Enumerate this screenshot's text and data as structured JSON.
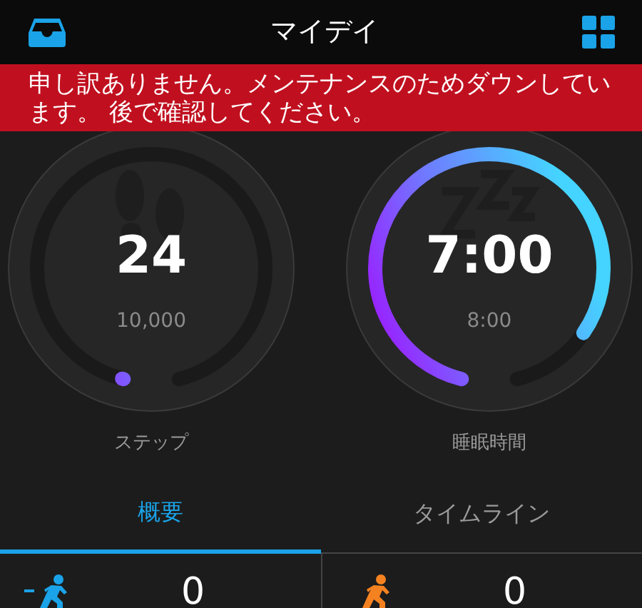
{
  "header": {
    "title": "マイデイ"
  },
  "banner": {
    "message": "申し訳ありません。メンテナンスのためダウンしています。 後で確認してください。"
  },
  "dials": [
    {
      "kind": "steps",
      "value": "24",
      "goal": "10,000",
      "label": "ステップ"
    },
    {
      "kind": "sleep",
      "value": "7:00",
      "goal": "8:00",
      "label": "睡眠時間"
    }
  ],
  "tabs": [
    {
      "label": "概要",
      "selected": true
    },
    {
      "label": "タイムライン",
      "selected": false
    }
  ],
  "stats": [
    {
      "kind": "intensity",
      "value": "0",
      "color": "#1aa3e8"
    },
    {
      "kind": "active",
      "value": "0",
      "color": "#f58220"
    }
  ]
}
